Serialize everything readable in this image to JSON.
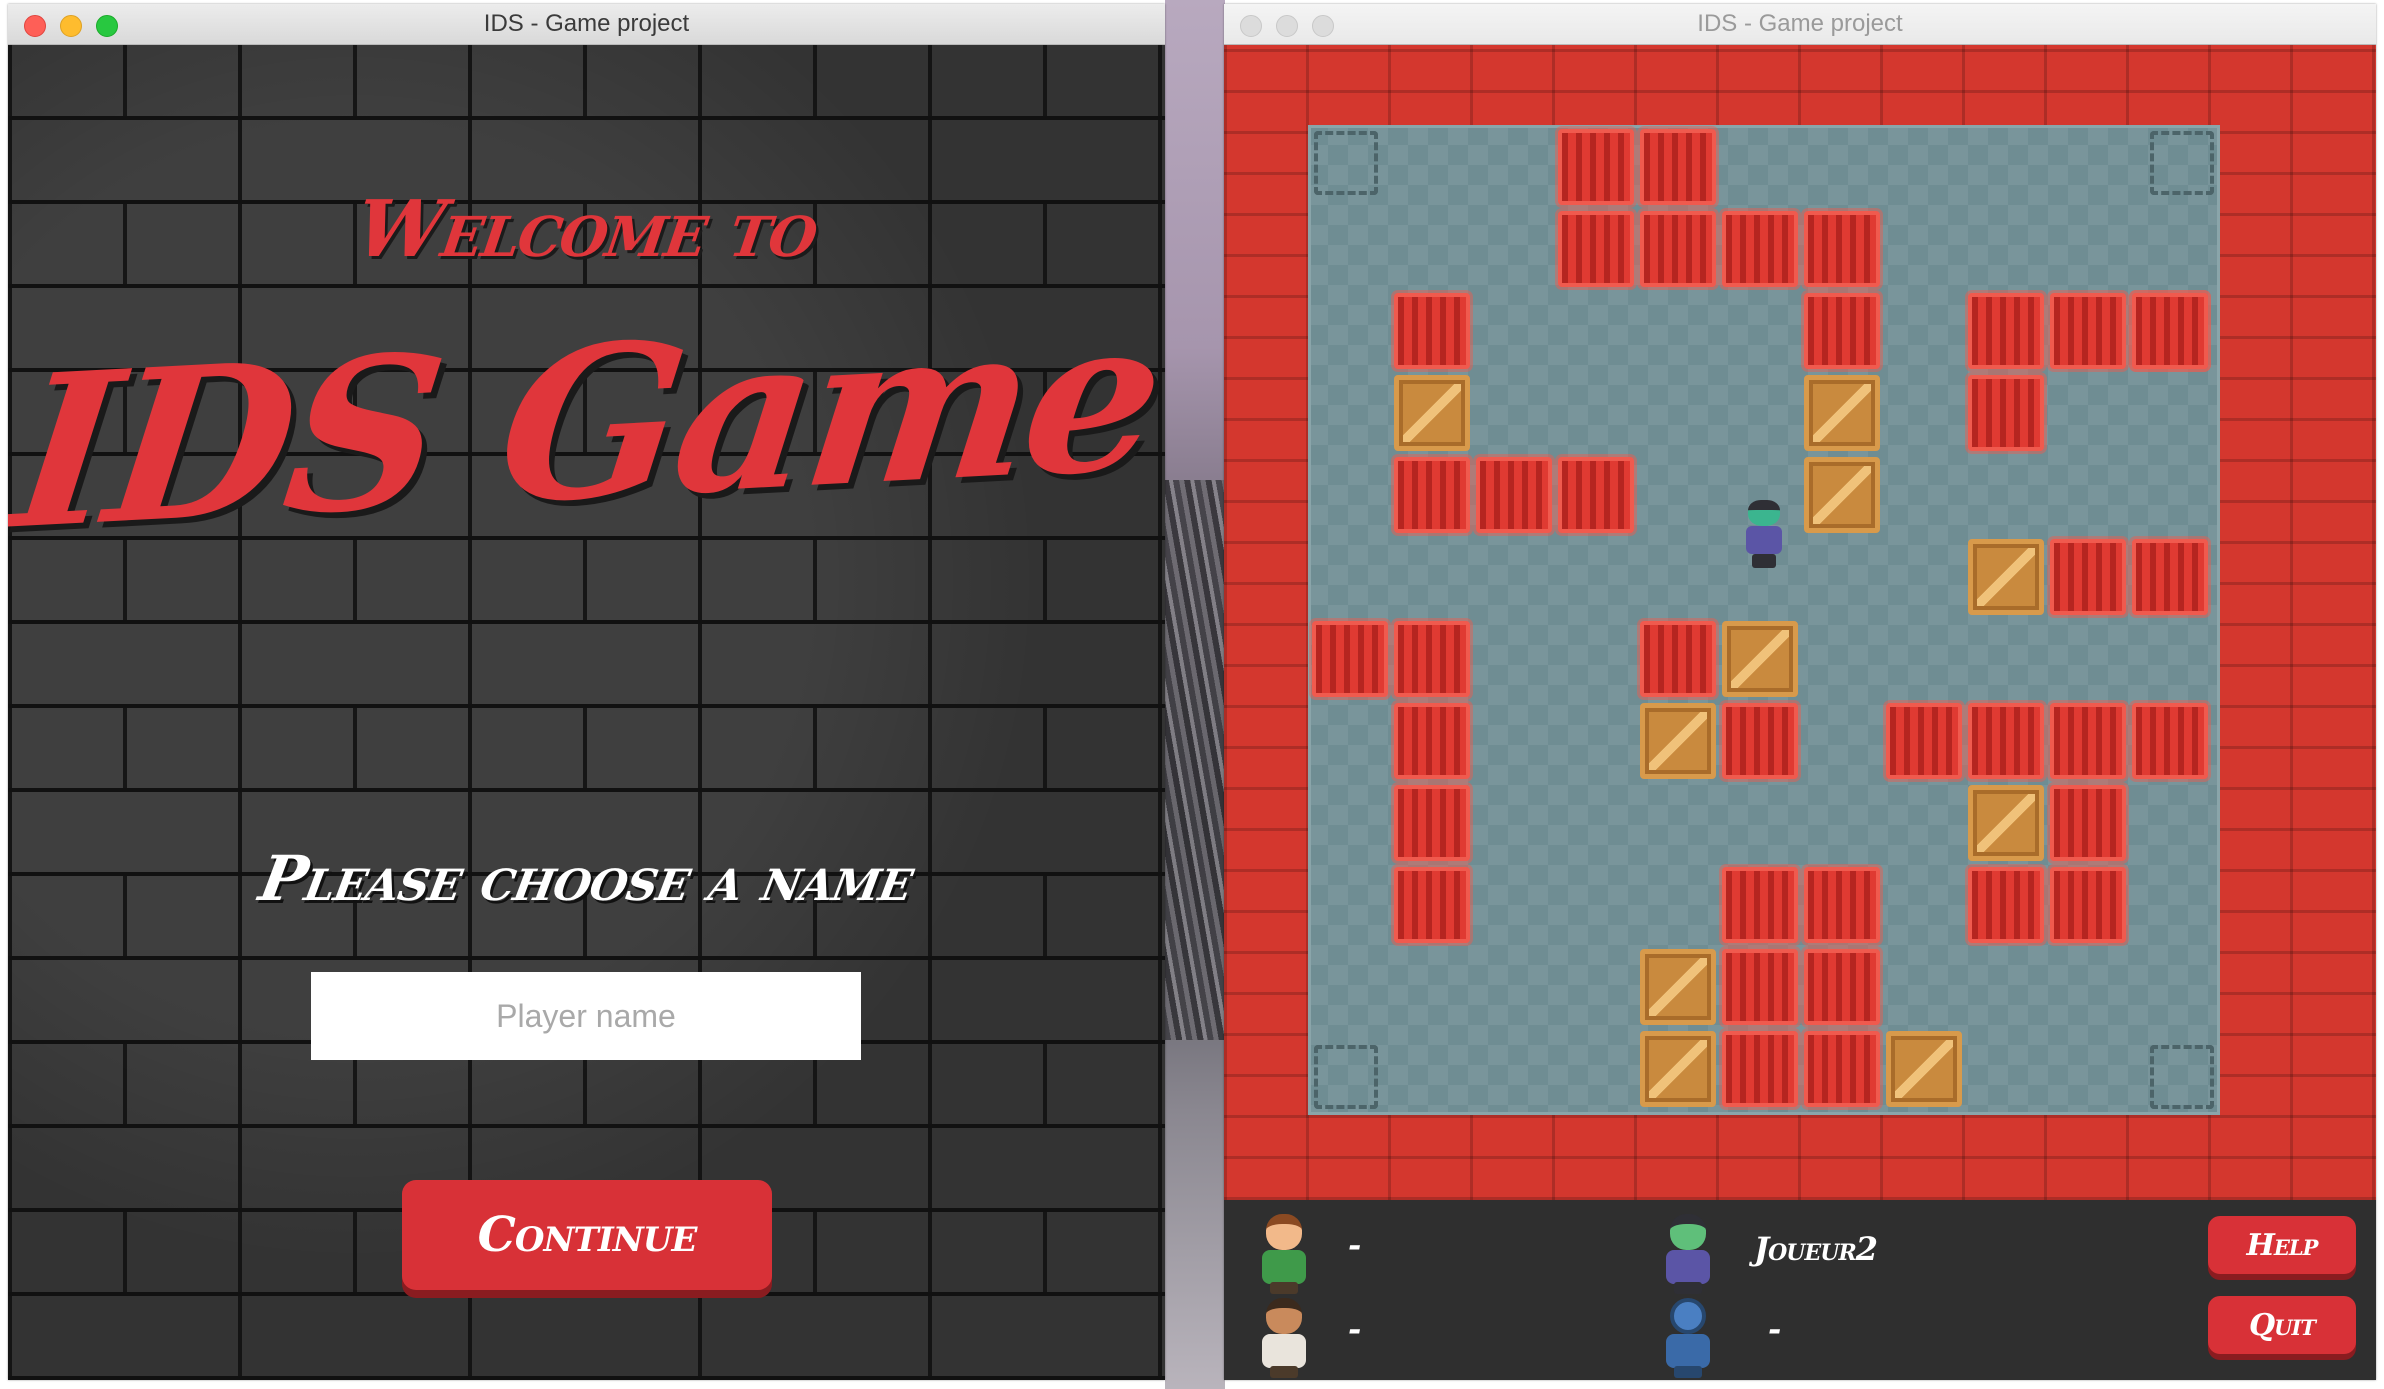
{
  "left_window": {
    "title": "IDS - Game project",
    "welcome_text": "Welcome to",
    "game_title": "IDS Game",
    "choose_prompt": "Please choose a name",
    "name_input": {
      "placeholder": "Player name",
      "value": ""
    },
    "continue_label": "Continue"
  },
  "right_window": {
    "title": "IDS - Game project",
    "hud": {
      "players": [
        {
          "name": "-",
          "avatar": "brown-haired-boy"
        },
        {
          "name": "Joueur2",
          "avatar": "green-zombie"
        },
        {
          "name": "-",
          "avatar": "bearded-man"
        },
        {
          "name": "-",
          "avatar": "blue-robot"
        }
      ],
      "help_label": "Help",
      "quit_label": "Quit"
    }
  },
  "colors": {
    "accent_red": "#d83137",
    "brick_dark": "#2b2b2b",
    "floor": "#6f8d93",
    "crate": "#c98a3e"
  }
}
